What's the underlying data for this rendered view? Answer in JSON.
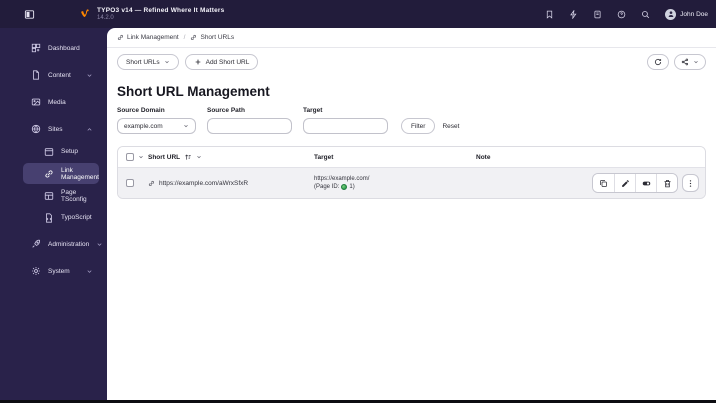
{
  "topbar": {
    "product_title": "TYPO3 v14 — Refined Where It Matters",
    "version": "14.2.0",
    "user_name": "John Doe"
  },
  "sidebar": {
    "items": [
      {
        "label": "Dashboard"
      },
      {
        "label": "Content"
      },
      {
        "label": "Media"
      },
      {
        "label": "Sites"
      },
      {
        "label": "Administration"
      },
      {
        "label": "System"
      }
    ],
    "sites_children": [
      {
        "label": "Setup"
      },
      {
        "label": "Link Management"
      },
      {
        "label": "Page TSconfig"
      },
      {
        "label": "TypoScript"
      }
    ]
  },
  "breadcrumb": {
    "separator": "/",
    "items": [
      {
        "label": "Link Management"
      },
      {
        "label": "Short URLs"
      }
    ]
  },
  "toolbar": {
    "view_switcher_label": "Short URLs",
    "add_button_label": "Add Short URL"
  },
  "page": {
    "title": "Short URL Management"
  },
  "filters": {
    "source_domain": {
      "label": "Source Domain",
      "value": "example.com"
    },
    "source_path": {
      "label": "Source Path",
      "value": ""
    },
    "target": {
      "label": "Target",
      "value": ""
    },
    "filter_button_label": "Filter",
    "reset_button_label": "Reset"
  },
  "table": {
    "columns": {
      "short_url": "Short URL",
      "target": "Target",
      "note": "Note"
    },
    "rows": [
      {
        "short_url": "https://example.com/aWrxSfxR",
        "target_url": "https://example.com/",
        "page_id_prefix": "(Page ID:",
        "page_id_value": "1)",
        "note": ""
      }
    ]
  },
  "icons": {
    "panel-toggle-icon": "half-filled square",
    "typo3-logo": "#ff8700",
    "bookmark-icon": "bookmark",
    "bolt-icon": "lightning",
    "docs-icon": "document",
    "help-icon": "circled question",
    "search-icon": "magnifier",
    "refresh-icon": "circular arrow",
    "share-icon": "share nodes",
    "link-icon": "chain link",
    "sort-ascending-icon": "arrow up with bars",
    "copy-icon": "duplicate squares",
    "edit-icon": "pencil",
    "toggle-icon": "switch",
    "delete-icon": "trash can",
    "more-icon": "vertical ellipsis",
    "globe-icon": "green globe dot"
  }
}
